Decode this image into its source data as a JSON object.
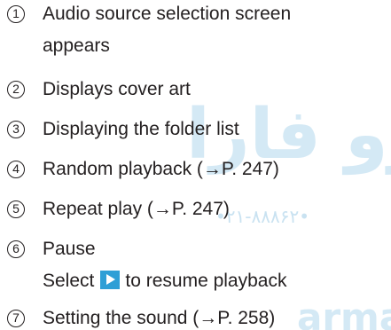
{
  "items": [
    {
      "num": "1",
      "text": "Audio source selection screen",
      "text2": "appears"
    },
    {
      "num": "2",
      "text": "Displays cover art"
    },
    {
      "num": "3",
      "text": "Displaying the folder list"
    },
    {
      "num": "4",
      "text": "Random playback (→P. 247)"
    },
    {
      "num": "5",
      "text": "Repeat play (→P. 247)"
    },
    {
      "num": "6",
      "text": "Pause",
      "text2_before": "Select",
      "icon": "play-icon",
      "text2_after": "to resume playback"
    },
    {
      "num": "7",
      "text": "Setting the sound (→P. 258)"
    }
  ],
  "watermark": {
    "arabic": "درو فارا",
    "phone": "•۲۱-۸۸۸۶۲•",
    "latin": "armase",
    "color": "#d4e9f5"
  },
  "colors": {
    "text": "#231f20",
    "play_button": "#2e9fd6"
  }
}
